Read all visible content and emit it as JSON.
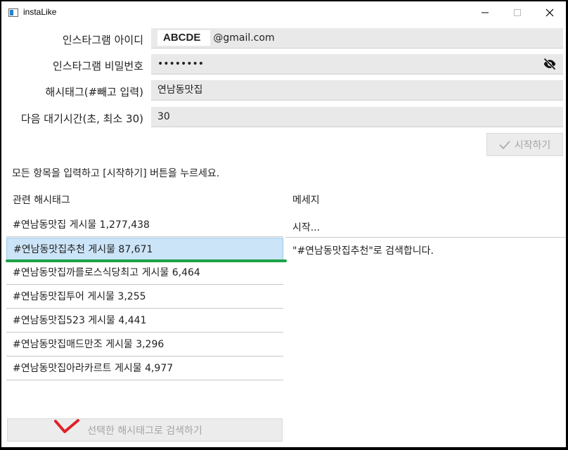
{
  "window": {
    "title": "instaLike"
  },
  "form": {
    "id_label": "인스타그램 아이디",
    "id_value_redacted": "ABCDE",
    "id_value_suffix": "@gmail.com",
    "password_label": "인스타그램 비밀번호",
    "password_value": "••••••••",
    "hashtag_label": "해시태그(#빼고 입력)",
    "hashtag_value": "연남동맛집",
    "wait_label": "다음 대기시간(초, 최소 30)",
    "wait_value": "30",
    "start_button": "시작하기"
  },
  "instruction": "모든 항목을 입력하고 [시작하기] 버튼을 누르세요.",
  "related": {
    "header": "관련 해시태그",
    "items": [
      "#연남동맛집 게시물 1,277,438",
      "#연남동맛집추천 게시물 87,671",
      "#연남동맛집까를로스식당최고 게시물 6,464",
      "#연남동맛집투어 게시물 3,255",
      "#연남동맛집523 게시물 4,441",
      "#연남동맛집매드만조 게시물 3,296",
      "#연남동맛집아라카르트 게시물 4,977"
    ],
    "selected_index": 1
  },
  "messages": {
    "header": "메세지",
    "status": "시작...",
    "text": "\"#연남동맛집추천\"로 검색합니다."
  },
  "search_button": "선택한 해시태그로 검색하기",
  "colors": {
    "selection": "#cce4f7",
    "annotation_green": "#1fa24a",
    "annotation_red": "#e0202a"
  }
}
